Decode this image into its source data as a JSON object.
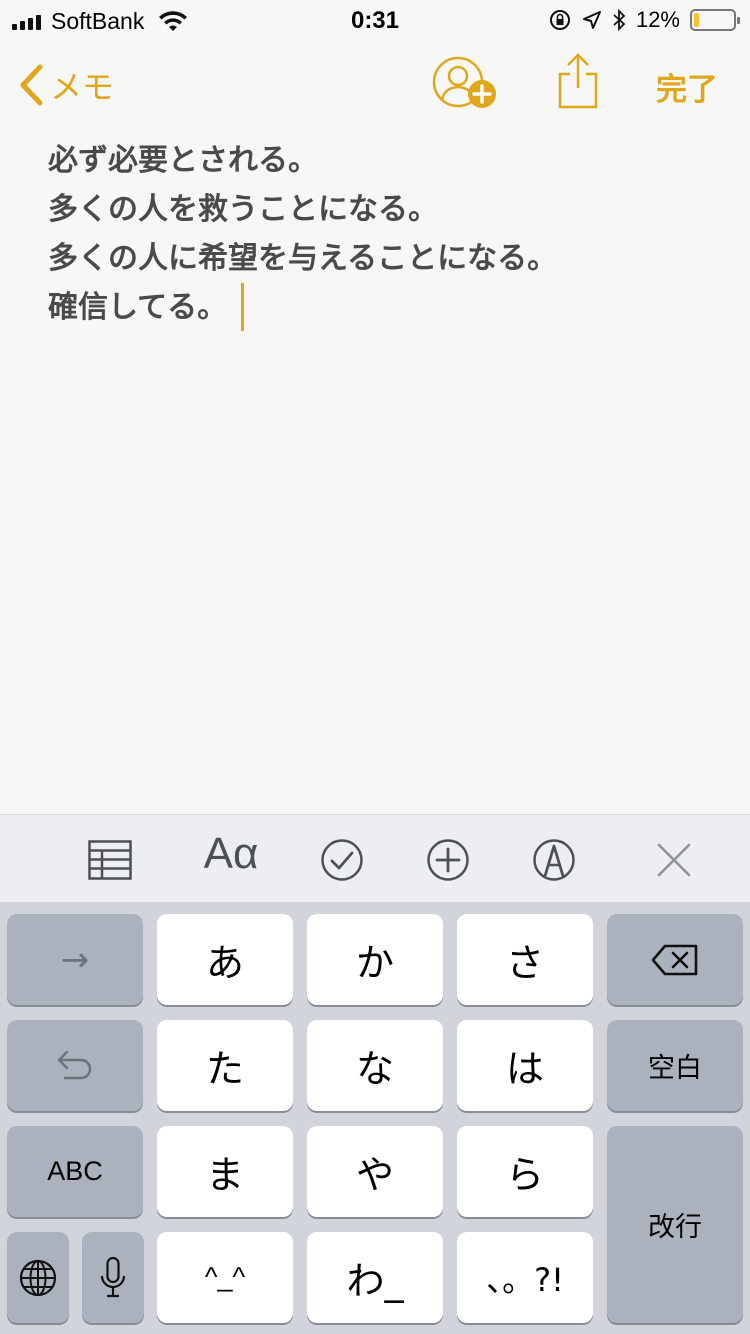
{
  "status_bar": {
    "carrier": "SoftBank",
    "time": "0:31",
    "battery_percent": "12%",
    "battery_level": 0.12
  },
  "nav": {
    "back_label": "メモ",
    "done_label": "完了"
  },
  "note": {
    "lines": [
      "必ず必要とされる。",
      "多くの人を救うことになる。",
      "多くの人に希望を与えることになる。",
      "確信してる。"
    ]
  },
  "toolbar": {
    "format_label": "Aα"
  },
  "keyboard": {
    "right_arrow": "→",
    "kana": {
      "a": "あ",
      "ka": "か",
      "sa": "さ",
      "ta": "た",
      "na": "な",
      "ha": "は",
      "ma": "ま",
      "ya": "や",
      "ra": "ら",
      "kaomoji": "^_^",
      "wa": "わ_",
      "punct": "、。?!"
    },
    "space_label": "空白",
    "abc_label": "ABC",
    "return_label": "改行"
  },
  "colors": {
    "accent": "#e0a71c",
    "note_text": "#4a4a4a",
    "keyboard_bg": "#d1d4da",
    "key_gray": "#acb2bd"
  }
}
